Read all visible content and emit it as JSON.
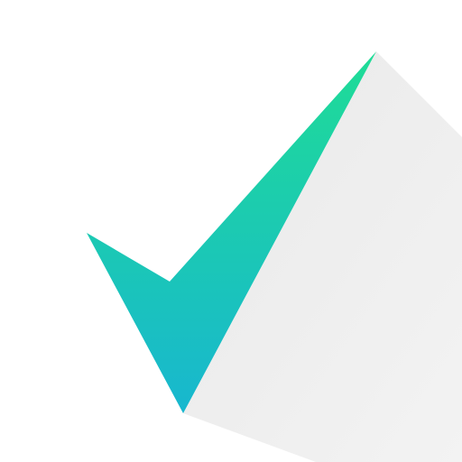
{
  "icon": {
    "name": "checkmark-icon",
    "colors": {
      "background": "#ffffff",
      "check_top": "#1fdc96",
      "check_bottom": "#18b7cf",
      "shadow": "#e9e9e9"
    }
  }
}
